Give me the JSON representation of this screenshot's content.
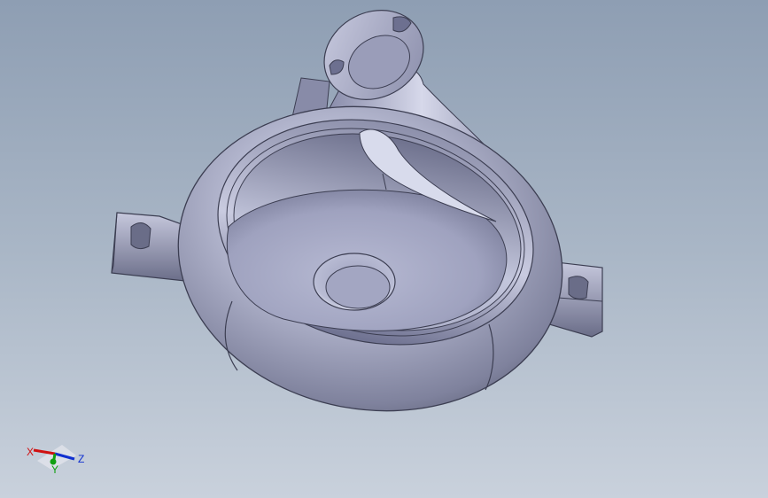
{
  "view": {
    "background_top": "#8e9eb3",
    "background_bottom": "#c9d1dc",
    "part_color": "#a6a9c4"
  },
  "triad": {
    "x_label": "X",
    "y_label": "Y",
    "z_label": "Z",
    "x_color": "#d01010",
    "y_color": "#10a010",
    "z_color": "#1030d0"
  }
}
